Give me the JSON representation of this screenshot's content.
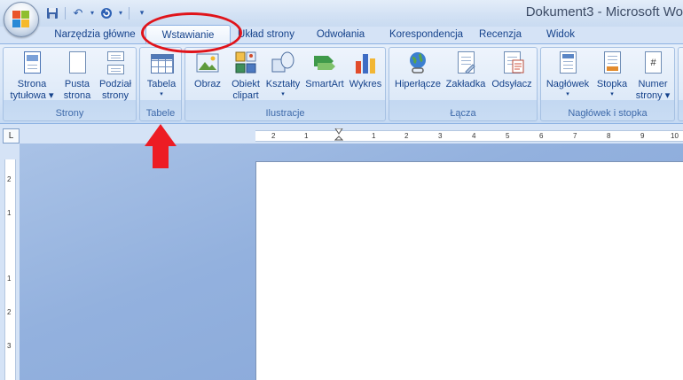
{
  "window": {
    "title": "Dokument3 - Microsoft Wo"
  },
  "quick_access": {
    "items": [
      "save-icon",
      "undo-icon",
      "redo-icon",
      "customize-icon"
    ]
  },
  "tabs": [
    {
      "label": "Narzędzia główne"
    },
    {
      "label": "Wstawianie",
      "active": true
    },
    {
      "label": "Układ strony"
    },
    {
      "label": "Odwołania"
    },
    {
      "label": "Korespondencja"
    },
    {
      "label": "Recenzja"
    },
    {
      "label": "Widok"
    }
  ],
  "groups": {
    "strony": {
      "label": "Strony",
      "buttons": [
        {
          "line1": "Strona",
          "line2": "tytułowa ▾"
        },
        {
          "line1": "Pusta",
          "line2": "strona"
        },
        {
          "line1": "Podział",
          "line2": "strony"
        }
      ]
    },
    "tabele": {
      "label": "Tabele",
      "buttons": [
        {
          "line1": "Tabela",
          "line2": "▾"
        }
      ]
    },
    "ilustracje": {
      "label": "Ilustracje",
      "buttons": [
        {
          "line1": "Obraz"
        },
        {
          "line1": "Obiekt",
          "line2": "clipart"
        },
        {
          "line1": "Kształty",
          "line2": "▾"
        },
        {
          "line1": "SmartArt"
        },
        {
          "line1": "Wykres"
        }
      ]
    },
    "lacza": {
      "label": "Łącza",
      "buttons": [
        {
          "line1": "Hiperłącze"
        },
        {
          "line1": "Zakładka"
        },
        {
          "line1": "Odsyłacz"
        }
      ]
    },
    "naglowek": {
      "label": "Nagłówek i stopka",
      "buttons": [
        {
          "line1": "Nagłówek",
          "line2": "▾"
        },
        {
          "line1": "Stopka",
          "line2": "▾"
        },
        {
          "line1": "Numer",
          "line2": "strony ▾"
        }
      ]
    }
  },
  "ruler": {
    "corner": "L",
    "h_ticks": [
      "2",
      "1",
      "1",
      "2",
      "3",
      "4",
      "5",
      "6",
      "7",
      "8",
      "9",
      "10"
    ],
    "v_ticks": [
      "2",
      "1",
      "1",
      "2",
      "3"
    ]
  },
  "colors": {
    "annotation_red": "#e0141b"
  }
}
